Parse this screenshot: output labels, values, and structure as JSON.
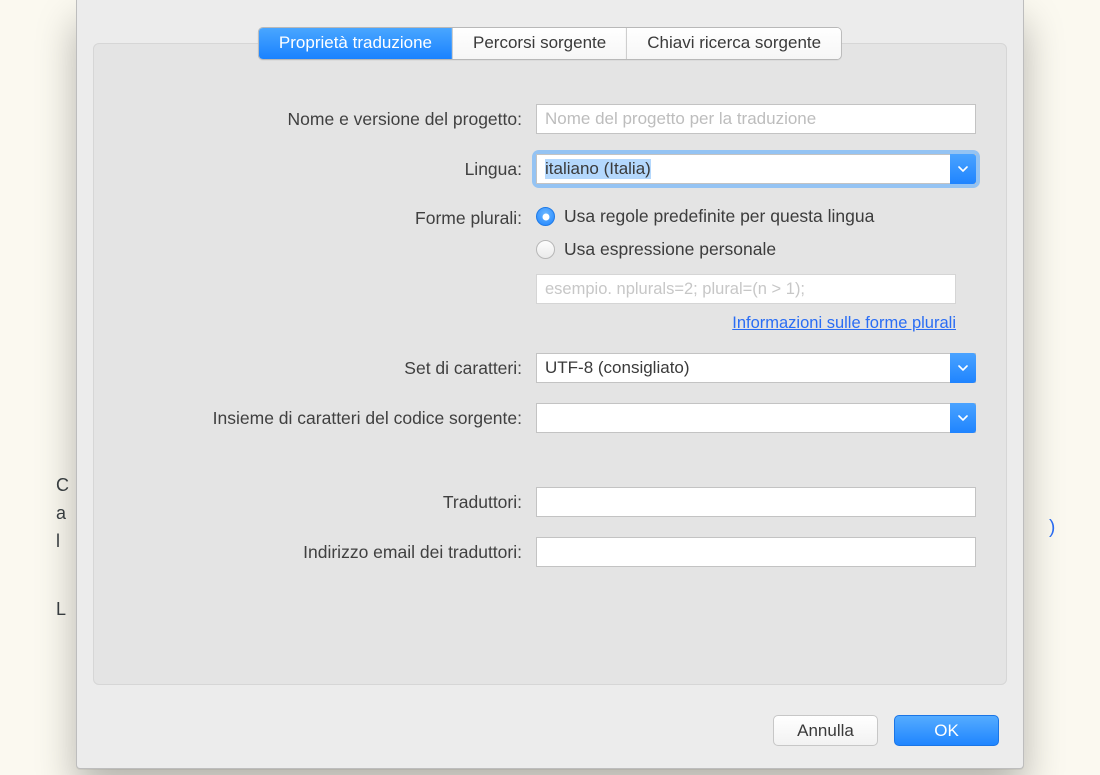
{
  "background": {
    "line1": "C",
    "line2": "a",
    "line3": "l",
    "line4": "L",
    "paren": ")"
  },
  "tabs": {
    "t1": "Proprietà traduzione",
    "t2": "Percorsi sorgente",
    "t3": "Chiavi ricerca sorgente"
  },
  "labels": {
    "project": "Nome e versione del progetto:",
    "language": "Lingua:",
    "plural": "Forme plurali:",
    "charset": "Set di caratteri:",
    "src_charset": "Insieme di caratteri del codice sorgente:",
    "translators": "Traduttori:",
    "email": "Indirizzo email dei traduttori:"
  },
  "fields": {
    "project_placeholder": "Nome del progetto per la traduzione",
    "project_value": "",
    "language_value": "italiano (Italia)",
    "plural_option1": "Usa regole predefinite per questa lingua",
    "plural_option2": "Usa espressione personale",
    "plural_example_placeholder": "esempio. nplurals=2; plural=(n > 1);",
    "plural_link": "Informazioni sulle forme plurali",
    "charset_value": "UTF-8 (consigliato)",
    "src_charset_value": "",
    "translators_value": "",
    "email_value": ""
  },
  "buttons": {
    "cancel": "Annulla",
    "ok": "OK"
  }
}
